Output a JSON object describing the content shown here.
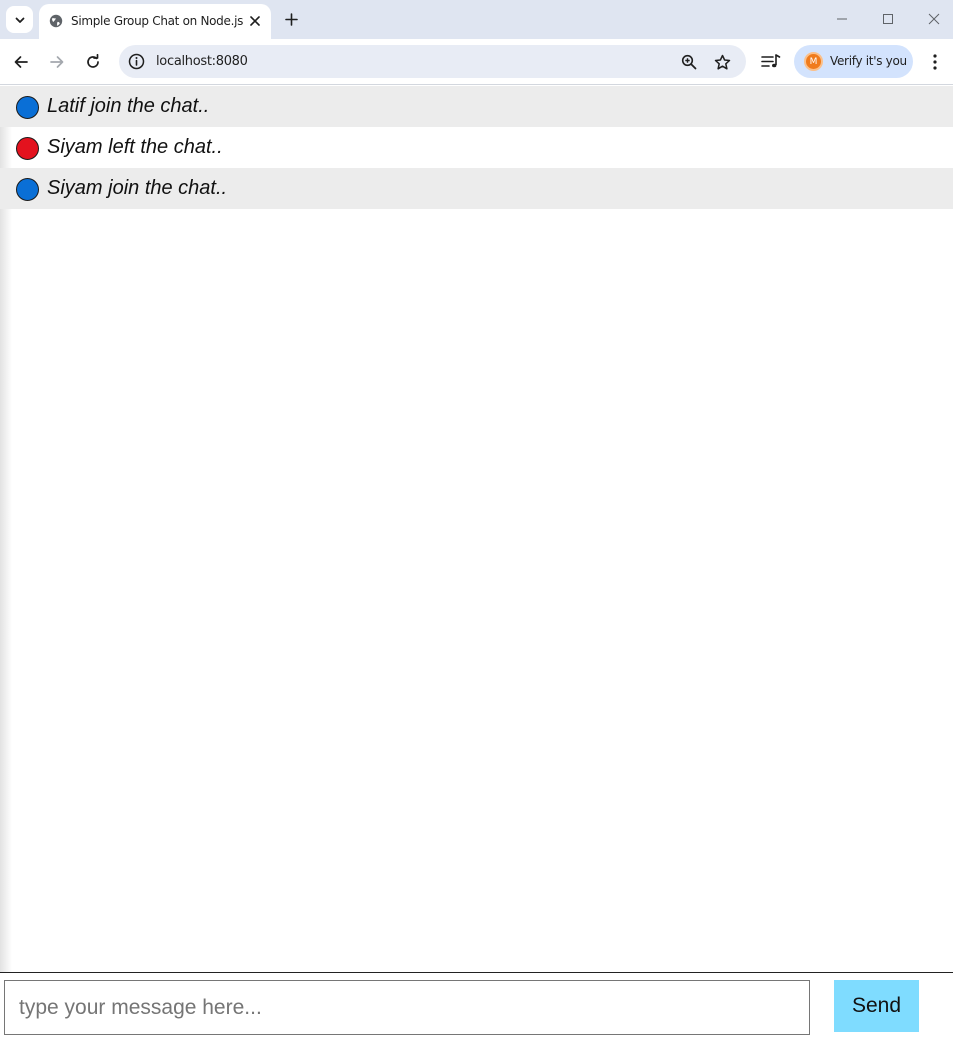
{
  "browser": {
    "tab_title": "Simple Group Chat on Node.js",
    "url": "localhost:8080",
    "profile_label": "Verify it's you",
    "profile_initial": "M"
  },
  "chat": {
    "messages": [
      {
        "text": "Latif join the chat..",
        "status": "join",
        "dot_color": "#0a6fd6"
      },
      {
        "text": "Siyam left the chat..",
        "status": "left",
        "dot_color": "#e3121e"
      },
      {
        "text": "Siyam join the chat..",
        "status": "join",
        "dot_color": "#0a6fd6"
      }
    ],
    "input_placeholder": "type your message here...",
    "input_value": "",
    "send_label": "Send"
  },
  "colors": {
    "send_button": "#7fdcff",
    "row_alternate": "#ececec",
    "join_dot": "#0a6fd6",
    "left_dot": "#e3121e"
  }
}
